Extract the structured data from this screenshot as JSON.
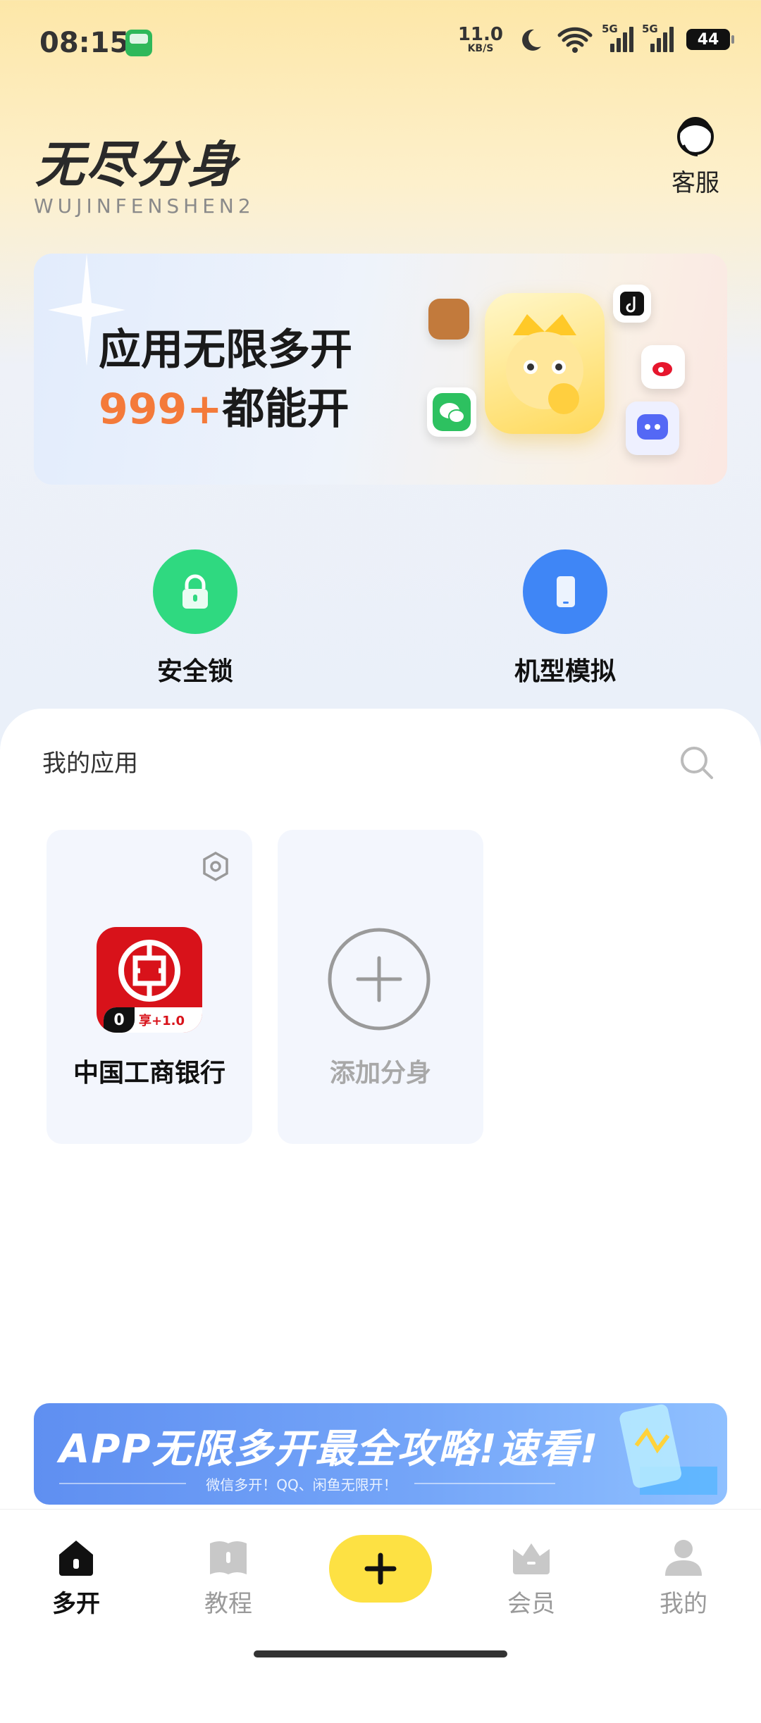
{
  "status_bar": {
    "time": "08:15",
    "net_speed": "11.0",
    "net_unit": "KB/S",
    "signal1": "5G",
    "signal2": "5G",
    "battery": "44"
  },
  "header": {
    "logo_title": "无尽分身",
    "logo_subtitle": "WUJINFENSHEN2",
    "service_label": "客服"
  },
  "banner": {
    "line1": "应用无限多开",
    "line2_number": "999+",
    "line2_rest": "都能开"
  },
  "tools": [
    {
      "label": "安全锁",
      "icon": "lock-icon",
      "color": "#2fd980"
    },
    {
      "label": "机型模拟",
      "icon": "phone-icon",
      "color": "#3f86f6"
    }
  ],
  "my_apps": {
    "title": "我的应用",
    "apps": [
      {
        "name": "中国工商银行",
        "badge_count": "0",
        "badge_text": "享+1.0"
      }
    ],
    "add_label": "添加分身"
  },
  "ad": {
    "title": "APP无限多开最全攻略!速看!",
    "subtitle": "微信多开！QQ、闲鱼无限开！"
  },
  "nav": {
    "items": [
      "多开",
      "教程",
      "会员",
      "我的"
    ],
    "active": "多开"
  }
}
